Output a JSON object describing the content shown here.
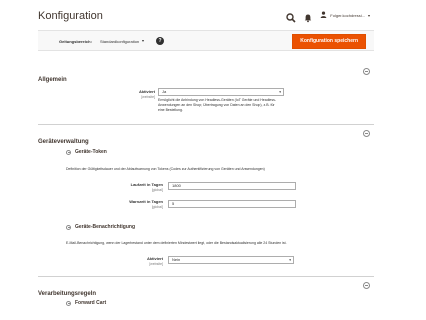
{
  "header": {
    "title": "Konfiguration",
    "user_name": "Folger.kochdressi..."
  },
  "scope": {
    "label": "Geltungsbereich:",
    "value": "Standardkonfiguration",
    "help": "?",
    "save_label": "Konfiguration speichern"
  },
  "sections": {
    "general": {
      "title": "Allgemein",
      "enabled_label": "Aktiviert",
      "enabled_scope": "[website]",
      "enabled_value": "Ja",
      "enabled_note": "Ermöglicht die Anbindung von Headless-Geräten (IoT Geräte und Headless-Anwendungen an den Shop; Übertragung von Daten an den Shop), z.B. für eine Bestellung."
    },
    "devices": {
      "title": "Geräteverwaltung",
      "tokens": {
        "title": "Geräte-Token",
        "description": "Definition der Gültigkeitsdauer und der Ablaufwarnung von Tokens (Codes zur Authentifizierung von Geräten und Anwendungen)",
        "lifetime_label": "Laufzeit in Tagen",
        "lifetime_scope": "[global]",
        "lifetime_value": "1800",
        "warning_label": "Warnzeit in Tagen",
        "warning_scope": "[global]",
        "warning_value": "5"
      },
      "notifications": {
        "title": "Geräte-Benachrichtigung",
        "description": "E-Mail-Benachrichtigung, wenn der Lagerbestand unter dem definierten Mindestwert liegt, oder die Bestandsaktualisierung alle 24 Stunden ist.",
        "enabled_label": "Aktiviert",
        "enabled_scope": "[website]",
        "enabled_value": "Nein"
      }
    },
    "rules": {
      "title": "Verarbeitungsregeln",
      "forward_cart": "Forward Cart"
    }
  }
}
